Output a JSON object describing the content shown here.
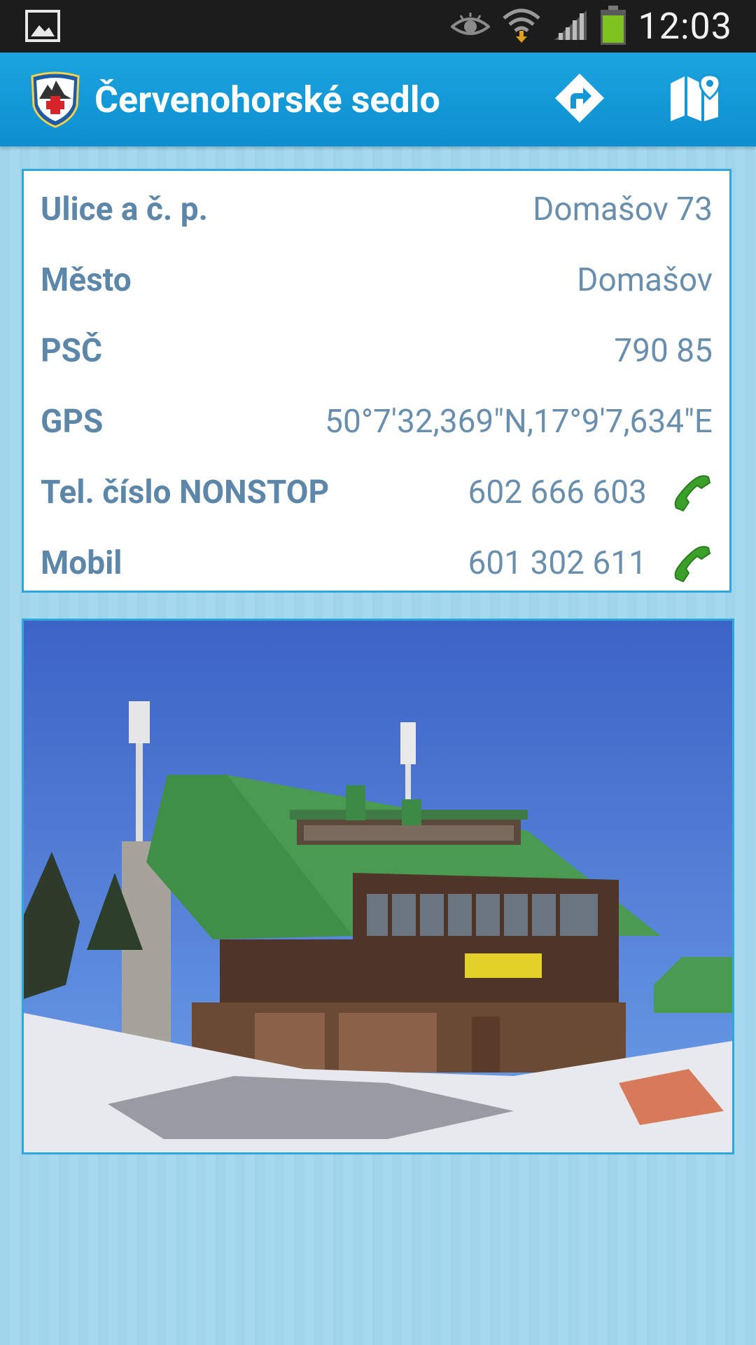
{
  "status_bar": {
    "time": "12:03",
    "icons": [
      "gallery-notification-icon",
      "eye-icon",
      "wifi-icon",
      "signal-icon",
      "battery-icon"
    ]
  },
  "action_bar": {
    "title": "Červenohorské sedlo",
    "logo": "mountain-rescue-logo",
    "actions": [
      {
        "name": "directions",
        "icon": "directions-icon"
      },
      {
        "name": "map",
        "icon": "map-icon"
      }
    ]
  },
  "details": {
    "rows": [
      {
        "label": "Ulice a č. p.",
        "value": "Domašov 73"
      },
      {
        "label": "Město",
        "value": "Domašov"
      },
      {
        "label": "PSČ",
        "value": "790 85"
      },
      {
        "label": "GPS",
        "value": "50°7'32,369\"N,17°9'7,634\"E"
      },
      {
        "label": "Tel. číslo NONSTOP",
        "value": "602 666 603",
        "icon": "phone-icon"
      },
      {
        "label": "Mobil",
        "value": "601 302 611",
        "icon": "phone-icon"
      }
    ]
  },
  "photo": {
    "subject": "mountain-hut-photo"
  },
  "colors": {
    "action_bar": "#1ba4e0",
    "card_border": "#2ea7dc",
    "label_text": "#5d87a8",
    "value_text": "#6a8fac",
    "phone_green": "#3aa02a",
    "background": "#a2d6ec"
  }
}
